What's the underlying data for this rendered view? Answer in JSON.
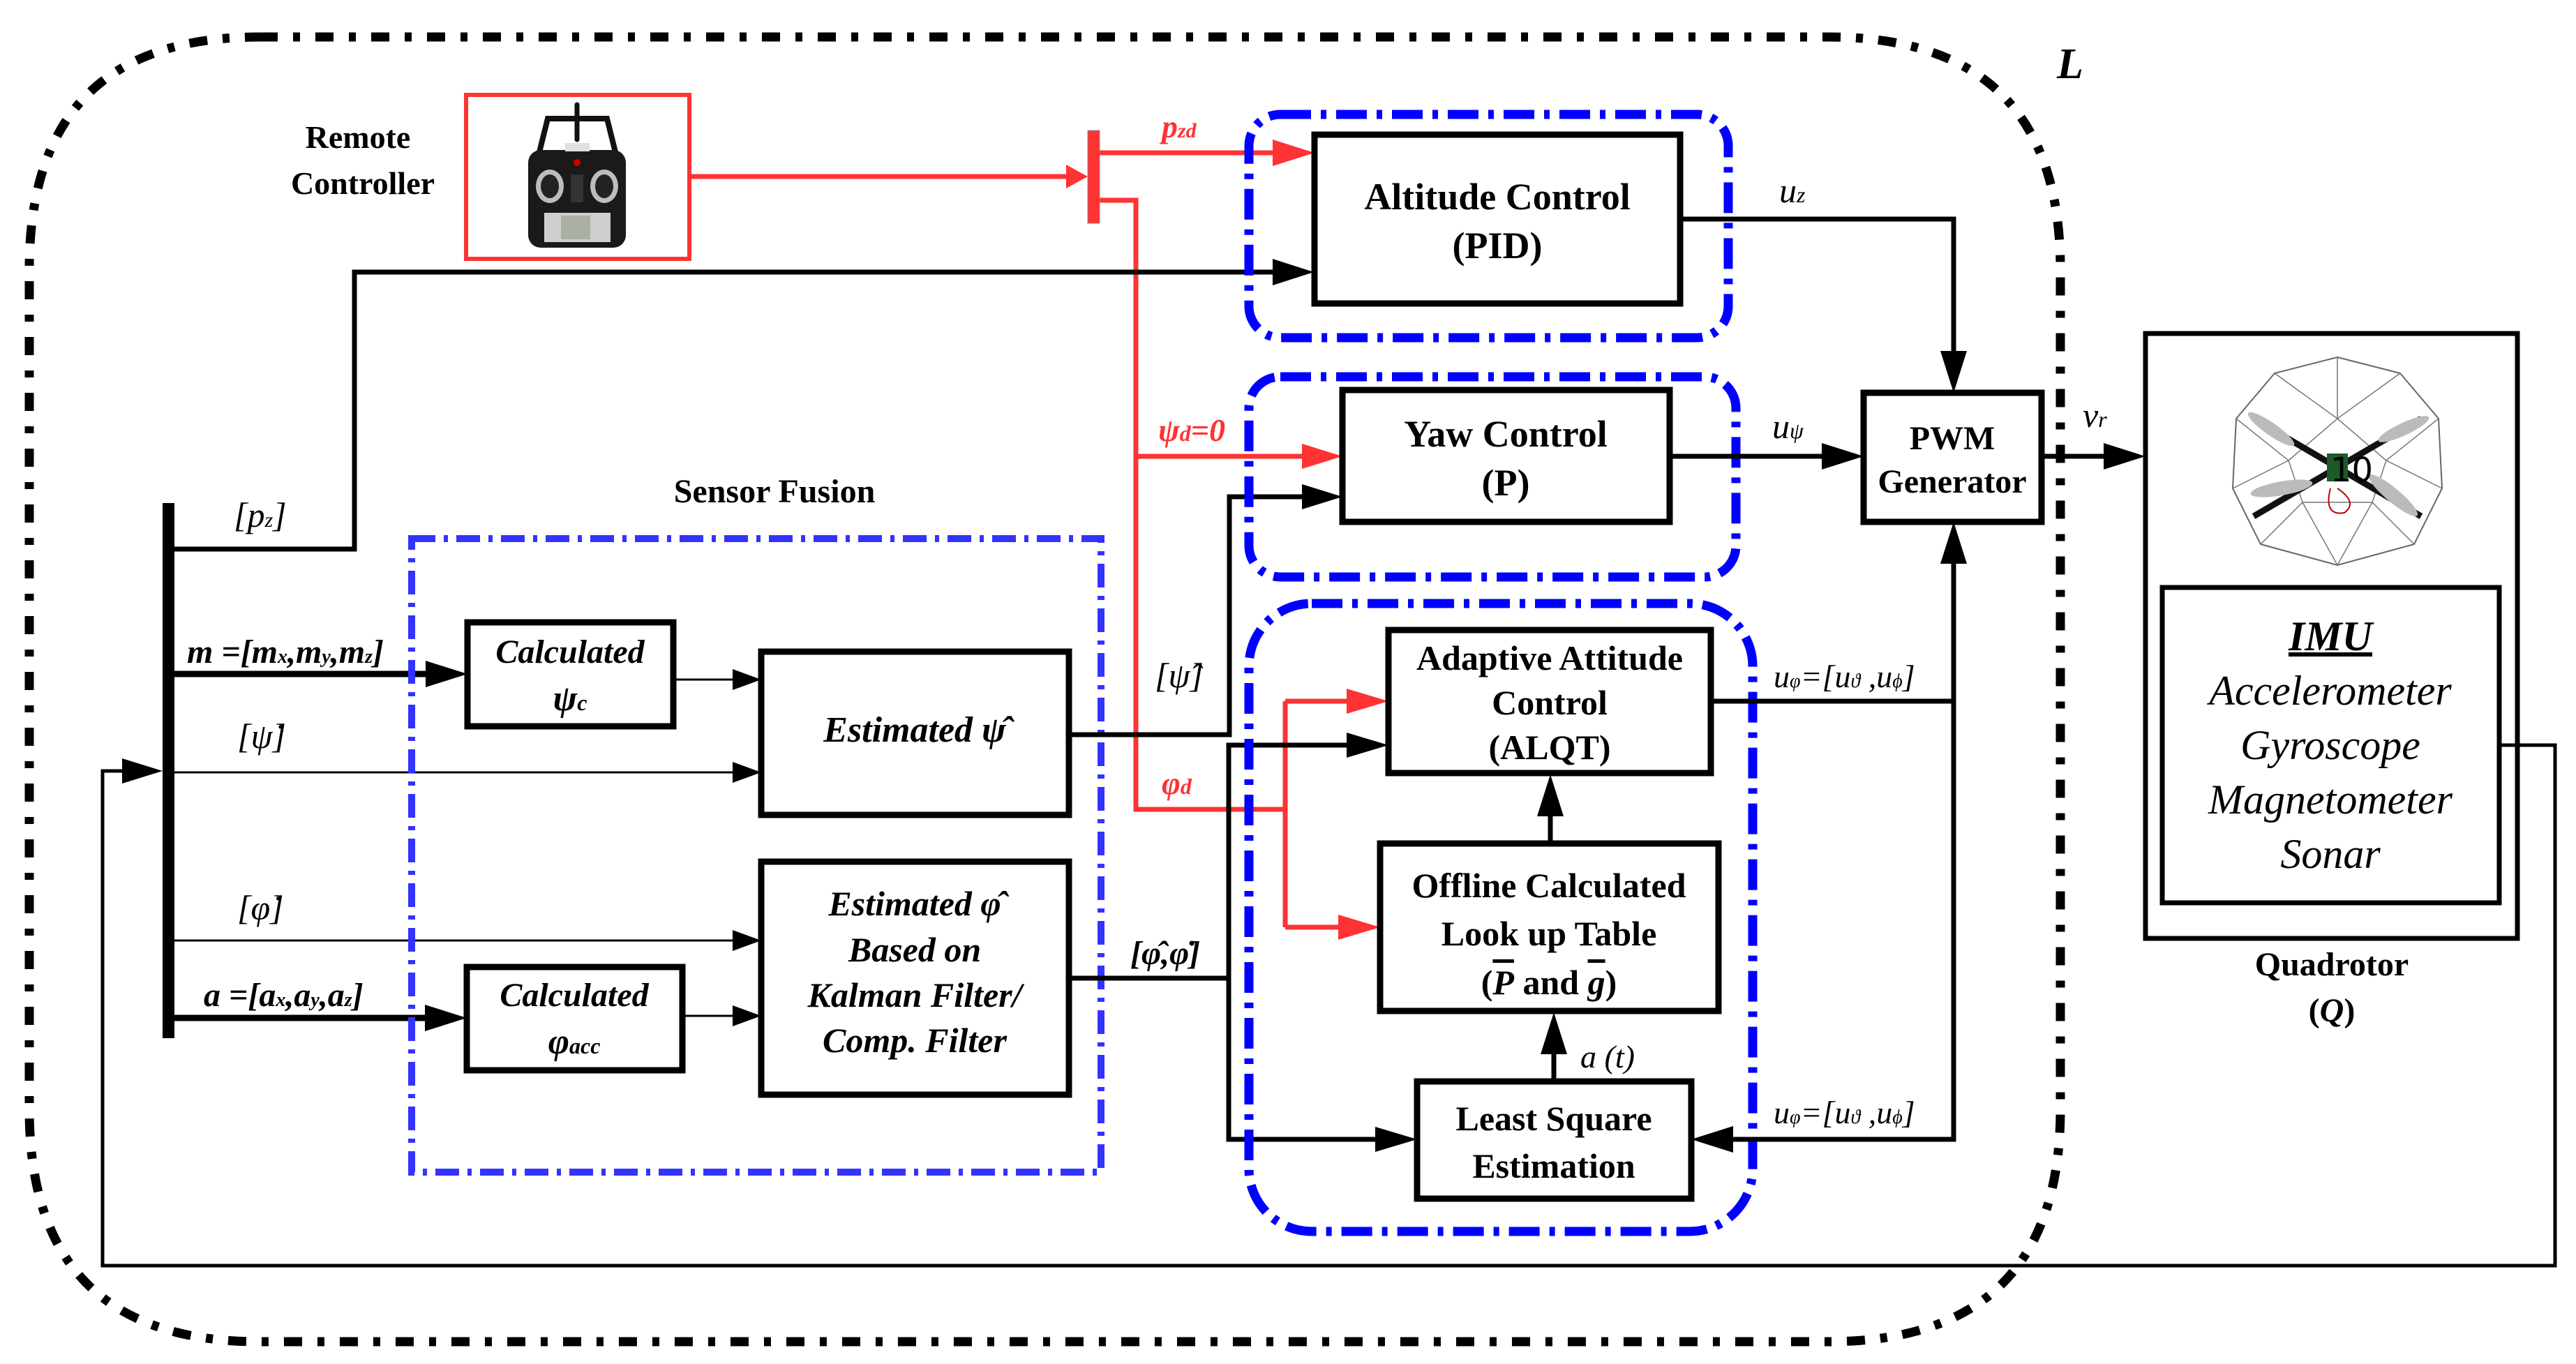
{
  "diagram": {
    "loop_label": "L",
    "remote_controller": {
      "label_line1": "Remote",
      "label_line2": "Controller",
      "image_alt": "remote-controller-photo"
    },
    "signals": {
      "pzd": "p",
      "pzd_sub": "zd",
      "psi_d": "ψ",
      "psi_d_sub": "d",
      "psi_d_eq": "=0",
      "phi_d": "φ",
      "phi_d_sub": "d",
      "pz_open": "[p",
      "pz_sub": "z",
      "pz_close": "]",
      "m_vec": "m =[m",
      "m_x": "x",
      "m_mid1": ",m",
      "m_y": "y",
      "m_mid2": ",m",
      "m_z": "z",
      "m_close": "]",
      "psi_dot": "[ψ̇]",
      "phi_dot": "[φ̇]",
      "a_vec": "a =[a",
      "a_x": "x",
      "a_mid1": ",a",
      "a_y": "y",
      "a_mid2": ",a",
      "a_z": "z",
      "a_close": "]",
      "psi_hat": "[ψ̂]",
      "phi_hat_dot": "[φ̂,φ̇]",
      "uz": "u",
      "uz_sub": "z",
      "upsi": "u",
      "upsi_sub": "ψ",
      "vr": "v",
      "vr_sub": "r",
      "uphi_top": "u",
      "uphi_top_sub": "φ",
      "uphi_top_rest": "=[u",
      "uphi_theta_sub": "ϑ",
      "uphi_comma": " ,u",
      "uphi_phi_sub": "ϕ",
      "uphi_close": "]",
      "a_t": "a (t)"
    },
    "sensor_fusion": {
      "title": "Sensor Fusion",
      "calc_psi": {
        "line1": "Calculated",
        "line2": "ψ",
        "line2_sub": "c"
      },
      "calc_phi": {
        "line1": "Calculated",
        "line2": "φ",
        "line2_sub": "acc"
      },
      "est_psi": {
        "line1": "Estimated ψ̂"
      },
      "est_phi": {
        "line1": "Estimated φ̂",
        "line2": "Based on",
        "line3": "Kalman Filter/",
        "line4": "Comp. Filter"
      }
    },
    "altitude_control": {
      "line1": "Altitude Control",
      "line2": "(PID)"
    },
    "yaw_control": {
      "line1": "Yaw Control",
      "line2": "(P)"
    },
    "adaptive_control": {
      "line1": "Adaptive Attitude",
      "line2": "Control",
      "line3": "(ALQT)"
    },
    "lookup_table": {
      "line1": "Offline Calculated",
      "line2": "Look up Table",
      "line3_open": "(",
      "line3_P": "P",
      "line3_and": " and ",
      "line3_g": "g",
      "line3_close": ")"
    },
    "least_square": {
      "line1": "Least Square",
      "line2": "Estimation"
    },
    "pwm": {
      "line1": "PWM",
      "line2": "Generator"
    },
    "quadrotor": {
      "label_line1": "Quadrotor",
      "label_line2_open": "(",
      "label_line2_Q": "Q",
      "label_line2_close": ")",
      "image_overlay_text": "10",
      "imu": {
        "title": "IMU",
        "sensors": [
          "Accelerometer",
          "Gyroscope",
          "Magnetometer",
          "Sonar"
        ]
      }
    },
    "colors": {
      "reference_signal": "#ff3333",
      "controller_group": "#0000ff",
      "sensor_fusion_group": "#3333ff",
      "block_stroke": "#000000"
    }
  }
}
